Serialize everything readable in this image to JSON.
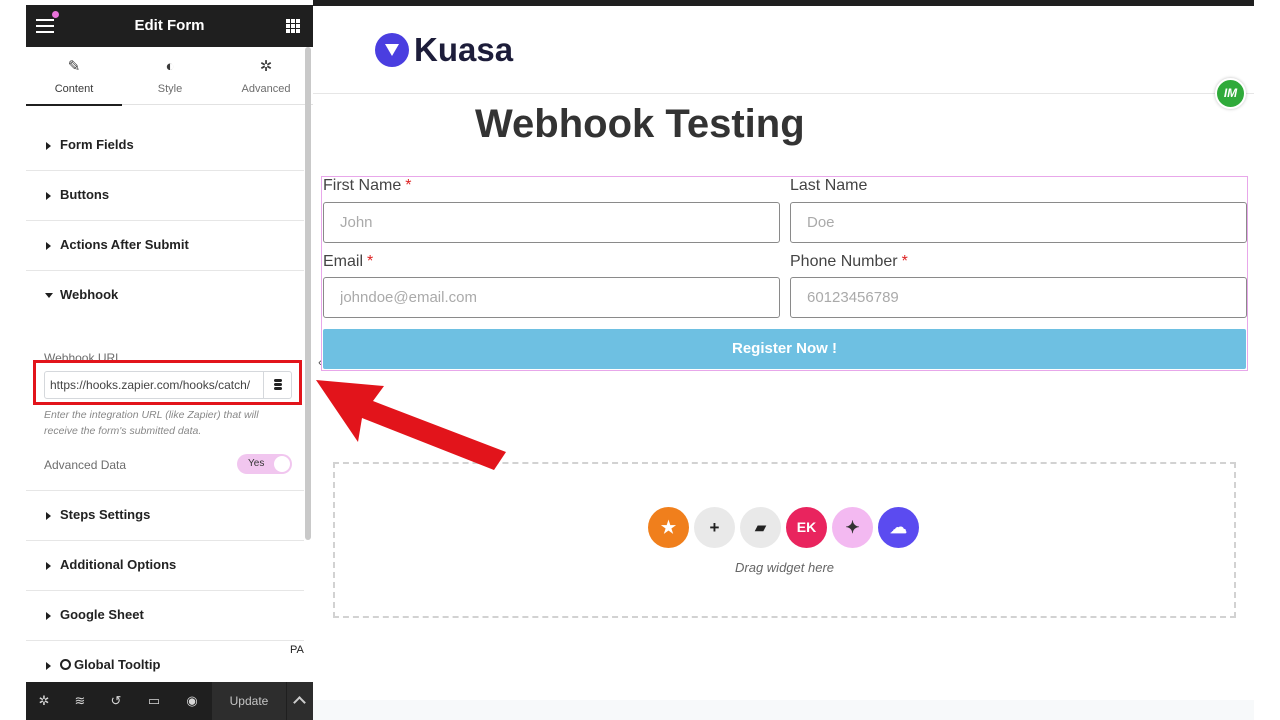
{
  "panel": {
    "title": "Edit Form",
    "tabs": [
      {
        "label": "Content",
        "icon": "pencil-icon",
        "active": true
      },
      {
        "label": "Style",
        "icon": "half-circle-icon",
        "active": false
      },
      {
        "label": "Advanced",
        "icon": "gear-icon",
        "active": false
      }
    ],
    "sections": {
      "form_fields": "Form Fields",
      "buttons": "Buttons",
      "actions_after_submit": "Actions After Submit",
      "webhook": "Webhook",
      "steps_settings": "Steps Settings",
      "additional_options": "Additional Options",
      "google_sheet": "Google Sheet",
      "global_tooltip": "Global Tooltip"
    },
    "webhook": {
      "url_label": "Webhook URL",
      "url_value": "https://hooks.zapier.com/hooks/catch/",
      "description": "Enter the integration URL (like Zapier) that will receive the form's submitted data.",
      "advanced_data_label": "Advanced Data",
      "advanced_data_state": "Yes"
    },
    "pa_badge": "PA",
    "footer": {
      "update_label": "Update"
    }
  },
  "canvas": {
    "logo_text": "Kuasa",
    "im_badge": "IM",
    "page_title": "Webhook Testing",
    "form": {
      "first_name_label": "First Name",
      "first_name_placeholder": "John",
      "last_name_label": "Last Name",
      "last_name_placeholder": "Doe",
      "email_label": "Email",
      "email_placeholder": "johndoe@email.com",
      "phone_label": "Phone Number",
      "phone_placeholder": "60123456789",
      "required_mark": "*",
      "submit_label": "Register Now !"
    },
    "dropzone_text": "Drag widget here"
  },
  "colors": {
    "panel_dark": "#1f1f1f",
    "submit_button": "#6ec0e2",
    "form_outline": "#e8a7ea",
    "annotation_red": "#e2141b",
    "logo_purple": "#4a3ee0"
  }
}
